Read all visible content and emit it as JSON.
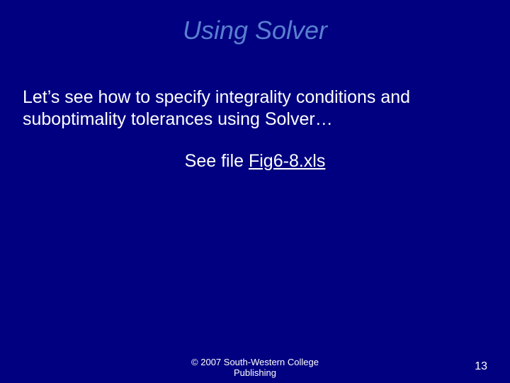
{
  "title": "Using Solver",
  "body_text": "Let’s see how to specify integrality conditions and suboptimality tolerances using Solver…",
  "see_file_prefix": "See file ",
  "see_file_link": "Fig6-8.xls",
  "footer_line1": "© 2007 South-Western College",
  "footer_line2": "Publishing",
  "page_number": "13"
}
